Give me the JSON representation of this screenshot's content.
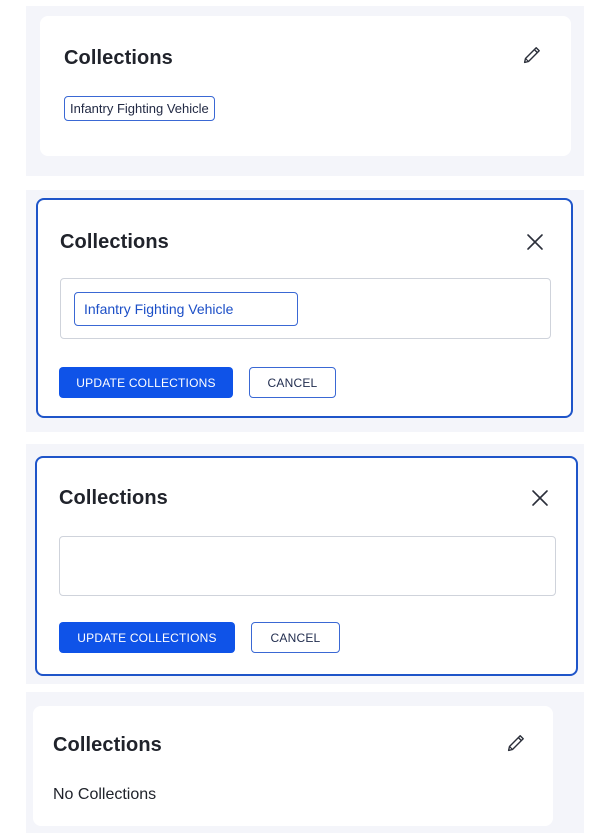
{
  "panel_view_with_collection": {
    "title": "Collections",
    "icon": "pencil-icon",
    "chip_label": "Infantry Fighting Vehicle"
  },
  "panel_edit_with_collection": {
    "title": "Collections",
    "icon": "close-icon",
    "chip_label": "Infantry Fighting Vehicle",
    "update_label": "UPDATE COLLECTIONS",
    "cancel_label": "CANCEL"
  },
  "panel_edit_empty": {
    "title": "Collections",
    "icon": "close-icon",
    "input_value": "",
    "update_label": "UPDATE COLLECTIONS",
    "cancel_label": "CANCEL"
  },
  "panel_view_empty": {
    "title": "Collections",
    "icon": "pencil-icon",
    "empty_text": "No Collections"
  },
  "colors": {
    "accent": "#0f53e8",
    "border": "#1f55c9",
    "page_bg": "#f4f5fa"
  }
}
